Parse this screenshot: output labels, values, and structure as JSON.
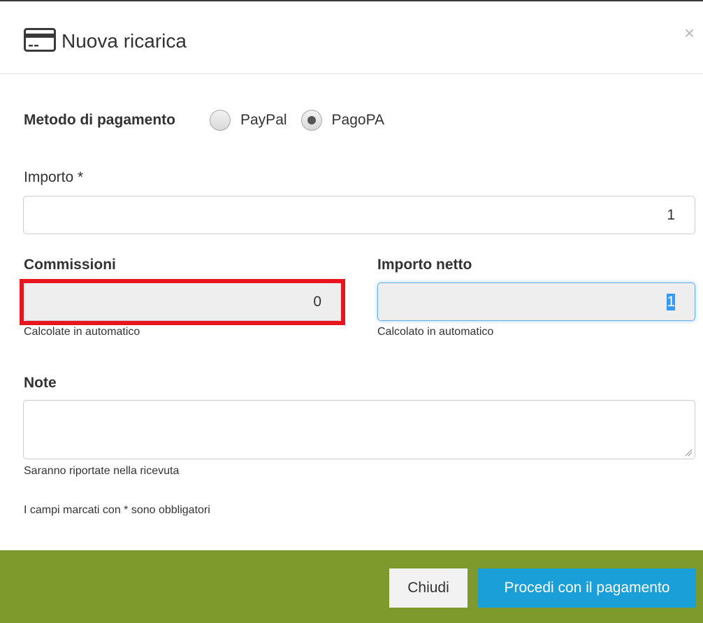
{
  "modal": {
    "title": "Nuova ricarica",
    "close_label": "×",
    "header_icon": "credit-card-icon"
  },
  "payment_method": {
    "label": "Metodo di pagamento",
    "options": [
      {
        "label": "PayPal",
        "selected": false
      },
      {
        "label": "PagoPA",
        "selected": true
      }
    ]
  },
  "importo": {
    "label": "Importo *",
    "value": "1"
  },
  "commissioni": {
    "label": "Commissioni",
    "value": "0",
    "help": "Calcolate in automatico"
  },
  "importo_netto": {
    "label": "Importo netto",
    "value": "1",
    "help": "Calcolato in automatico"
  },
  "note": {
    "label": "Note",
    "value": "",
    "help": "Saranno riportate nella ricevuta"
  },
  "required_notice": "I campi marcati con * sono obbligatori",
  "footer": {
    "close_button": "Chiudi",
    "proceed_button": "Procedi con il pagamento"
  },
  "colors": {
    "footer_bg": "#7e9a2c",
    "primary_button": "#1a9fd8",
    "highlight_border": "#e8141e"
  }
}
